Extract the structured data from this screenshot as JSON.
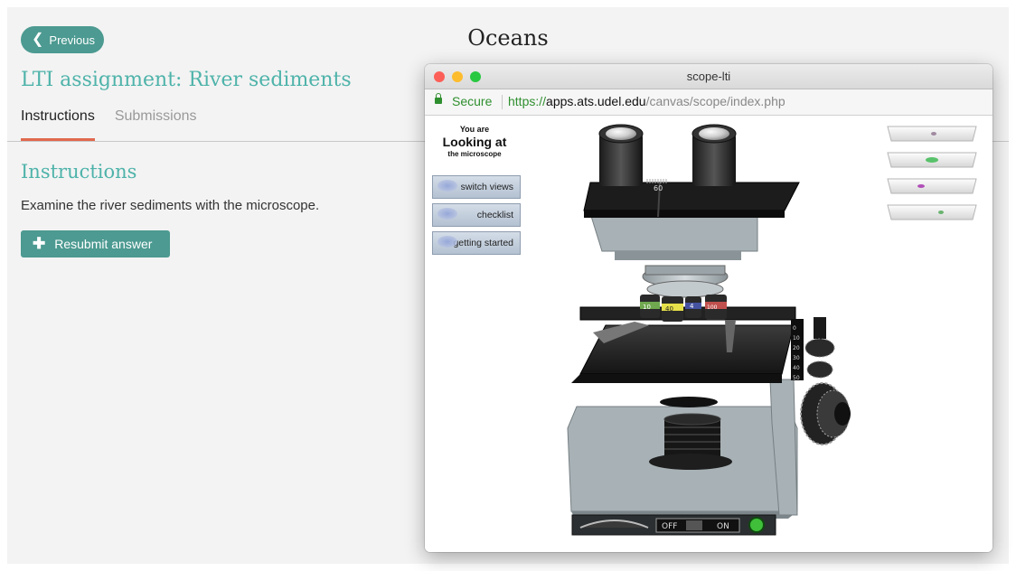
{
  "course": {
    "title": "Oceans"
  },
  "nav": {
    "previous_label": "Previous"
  },
  "assignment": {
    "title": "LTI assignment: River sediments",
    "tabs": [
      {
        "label": "Instructions",
        "active": true
      },
      {
        "label": "Submissions",
        "active": false
      }
    ],
    "section_heading": "Instructions",
    "instructions_text": "Examine the river sediments with the microscope.",
    "resubmit_label": "Resubmit answer"
  },
  "popup": {
    "window_title": "scope-lti",
    "security_label": "Secure",
    "url": {
      "scheme": "https://",
      "host": "apps.ats.udel.edu",
      "path": "/canvas/scope/index.php"
    },
    "status": {
      "line1": "You are",
      "line2": "Looking at",
      "line3": "the microscope"
    },
    "buttons": [
      {
        "label": "switch views"
      },
      {
        "label": "checklist"
      },
      {
        "label": "getting started"
      }
    ],
    "microscope": {
      "ocular_scale_label": "60",
      "objective_labels": [
        "10",
        "40",
        "4",
        "100"
      ],
      "stage_scale_labels": [
        "0",
        "10",
        "20",
        "30",
        "40",
        "50"
      ],
      "power_off_label": "OFF",
      "power_on_label": "ON"
    },
    "slides_count": 4
  },
  "colors": {
    "accent": "#4c9a91",
    "heading": "#4eb3aa",
    "tab_underline": "#e0694d",
    "secure_green": "#2f8f2f",
    "microscope_base": "#a8b2b6"
  }
}
